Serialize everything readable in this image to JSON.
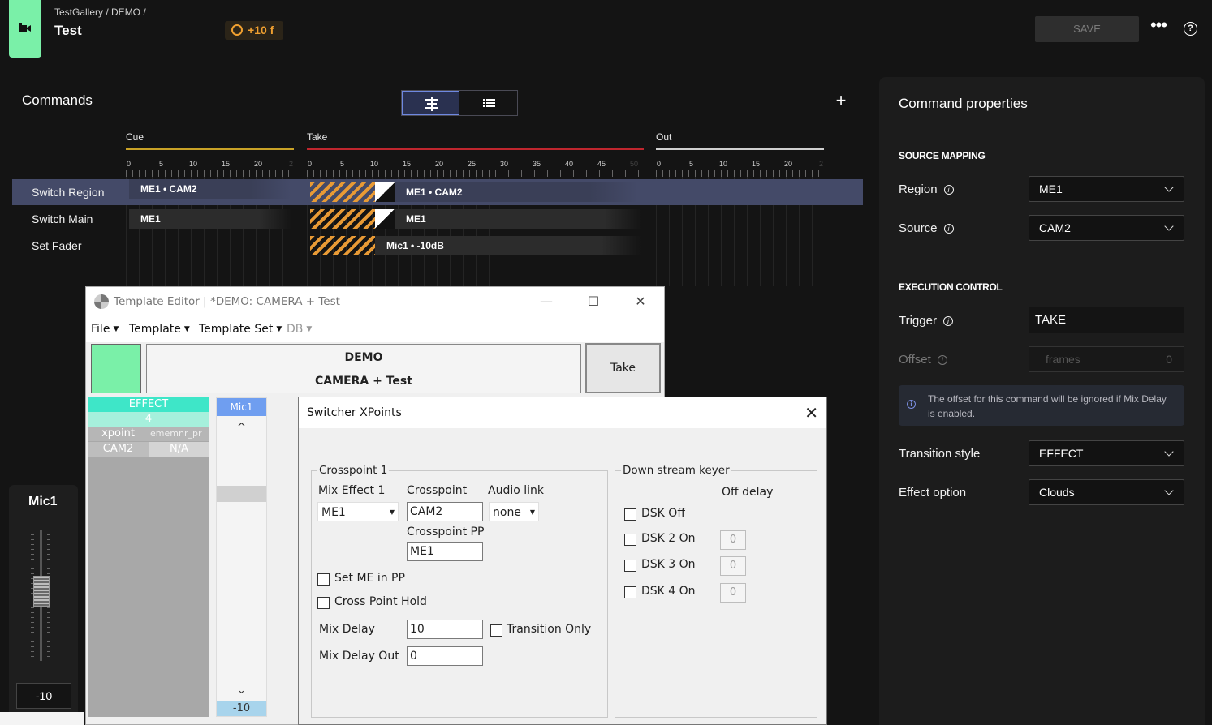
{
  "header": {
    "breadcrumb": "TestGallery / DEMO /",
    "title": "Test",
    "offset_badge": "+10 f",
    "save_label": "SAVE",
    "more_label": "•••",
    "help_label": "?"
  },
  "commands": {
    "title": "Commands",
    "add_label": "+",
    "sections": [
      {
        "name": "Cue",
        "color": "#c9a227",
        "ticks": [
          "0",
          "5",
          "10",
          "15",
          "20",
          "2"
        ]
      },
      {
        "name": "Take",
        "color": "#c0262e",
        "ticks": [
          "0",
          "5",
          "10",
          "15",
          "20",
          "25",
          "30",
          "35",
          "40",
          "45",
          "50"
        ]
      },
      {
        "name": "Out",
        "color": "#d0d0d0",
        "ticks": [
          "0",
          "5",
          "10",
          "15",
          "20",
          "2"
        ]
      }
    ],
    "rows": [
      {
        "name": "Switch Region",
        "cue_clip": "ME1 • CAM2",
        "take_clip": "ME1 • CAM2",
        "selected": true
      },
      {
        "name": "Switch Main",
        "cue_clip": "ME1",
        "take_clip": "ME1",
        "selected": false
      },
      {
        "name": "Set Fader",
        "cue_clip": "",
        "take_clip": "Mic1 • -10dB",
        "selected": false
      }
    ]
  },
  "properties": {
    "title": "Command properties",
    "source_mapping_heading": "SOURCE MAPPING",
    "region_label": "Region",
    "region_value": "ME1",
    "source_label": "Source",
    "source_value": "CAM2",
    "execution_heading": "EXECUTION CONTROL",
    "trigger_label": "Trigger",
    "trigger_value": "TAKE",
    "offset_label": "Offset",
    "offset_placeholder": "frames",
    "offset_value": "0",
    "info_text": "The offset for this command will be ignored if Mix Delay is enabled.",
    "transition_label": "Transition style",
    "transition_value": "EFFECT",
    "effect_label": "Effect option",
    "effect_value": "Clouds"
  },
  "mic": {
    "title": "Mic1",
    "value": "-10"
  },
  "template_editor": {
    "title": "Template Editor | *DEMO: CAMERA + Test",
    "menu": [
      "File",
      "Template",
      "Template Set",
      "DB"
    ],
    "name_line1": "DEMO",
    "name_line2": "CAMERA + Test",
    "take_label": "Take",
    "grid": {
      "effect": "EFFECT",
      "count": "4",
      "col1_header": "xpoint",
      "col2_header": "ememnr_pr",
      "col1_value": "CAM2",
      "col2_value": "N/A"
    },
    "mic_tab": "Mic1",
    "mic_value": "-10",
    "scroll_up": "^",
    "scroll_down": "⌄"
  },
  "switcher": {
    "title": "Switcher XPoints",
    "crosspoint_group": "Crosspoint 1",
    "mix_effect_label": "Mix Effect 1",
    "mix_effect_value": "ME1",
    "crosspoint_label": "Crosspoint",
    "crosspoint_value": "CAM2",
    "audio_link_label": "Audio link",
    "audio_link_value": "none",
    "crosspoint_pp_label": "Crosspoint PP",
    "crosspoint_pp_value": "ME1",
    "set_me_label": "Set ME in PP",
    "cross_hold_label": "Cross Point Hold",
    "mix_delay_label": "Mix Delay",
    "mix_delay_value": "10",
    "transition_only_label": "Transition Only",
    "mix_delay_out_label": "Mix Delay Out",
    "mix_delay_out_value": "0",
    "dsk_group": "Down stream keyer",
    "off_delay_label": "Off delay",
    "dsk_off_label": "DSK Off",
    "dsk2_label": "DSK 2 On",
    "dsk3_label": "DSK 3 On",
    "dsk4_label": "DSK 4 On",
    "dsk2_value": "0",
    "dsk3_value": "0",
    "dsk4_value": "0"
  }
}
